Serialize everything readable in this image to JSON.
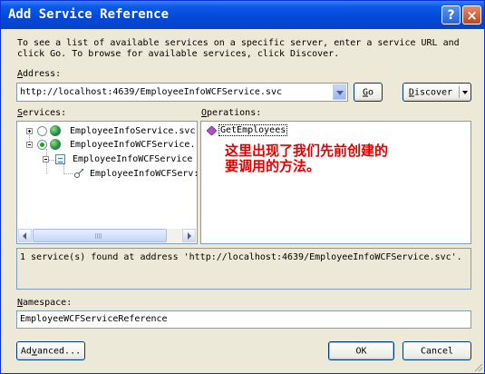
{
  "dialog": {
    "title": "Add Service Reference",
    "help_glyph": "?",
    "close_glyph": "×",
    "description_line1": "To see a list of available services on a specific server, enter a service URL and",
    "description_line2": "click Go. To browse for available services, click Discover."
  },
  "address": {
    "label_accel": "A",
    "label_rest": "ddress:",
    "value": "http://localhost:4639/EmployeeInfoWCFService.svc",
    "go_accel": "G",
    "go_rest": "o",
    "discover_accel": "D",
    "discover_rest": "iscover"
  },
  "services": {
    "label_accel": "S",
    "label_rest": "ervices:",
    "tree": [
      {
        "text": "EmployeeInfoService.svc",
        "expander": "+"
      },
      {
        "text": "EmployeeInfoWCFService.",
        "expander": "-"
      },
      {
        "text": "EmployeeInfoWCFService",
        "expander": "-"
      },
      {
        "text": "EmployeeInfoWCFServ:",
        "expander": ""
      }
    ]
  },
  "operations": {
    "label_accel": "O",
    "label_rest": "perations:",
    "items": [
      "GetEmployees"
    ],
    "annotation_line1": "这里出现了我们先前创建的",
    "annotation_line2": "要调用的方法。"
  },
  "status": {
    "text": "1 service(s) found at address 'http://localhost:4639/EmployeeInfoWCFService.svc'."
  },
  "namespace": {
    "label_accel": "N",
    "label_rest": "amespace:",
    "value": "EmployeeWCFServiceReference"
  },
  "buttons": {
    "advanced_pre": "Ad",
    "advanced_accel": "v",
    "advanced_rest": "anced...",
    "ok": "OK",
    "cancel": "Cancel"
  },
  "colors": {
    "titlebar": "#0548d8",
    "annotation": "#e00000",
    "dialog_bg": "#ece9d8"
  }
}
